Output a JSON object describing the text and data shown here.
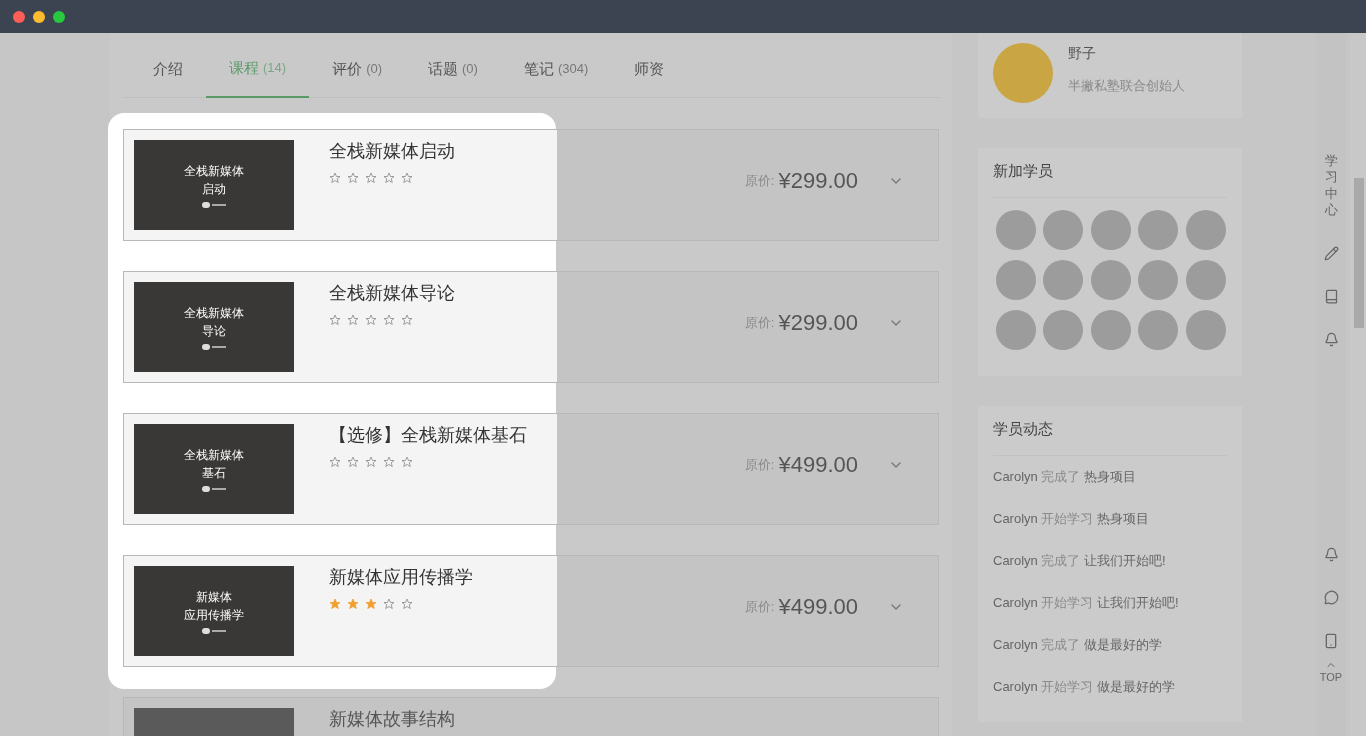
{
  "tabs": [
    {
      "label": "介绍",
      "selected": false
    },
    {
      "label": "课程",
      "count": "(14)",
      "selected": true
    },
    {
      "label": "评价",
      "count": "(0)",
      "selected": false
    },
    {
      "label": "话题",
      "count": "(0)",
      "selected": false
    },
    {
      "label": "笔记",
      "count": "(304)",
      "selected": false
    },
    {
      "label": "师资",
      "selected": false
    }
  ],
  "courses": [
    {
      "title": "全栈新媒体启动",
      "thumb_lines": [
        "全栈新媒体",
        "启动"
      ],
      "stars": 0,
      "price_label": "原价:",
      "price": "¥299.00",
      "highlighted": true
    },
    {
      "title": "全栈新媒体导论",
      "thumb_lines": [
        "全栈新媒体",
        "导论"
      ],
      "stars": 0,
      "price_label": "原价:",
      "price": "¥299.00",
      "highlighted": true
    },
    {
      "title": "【选修】全栈新媒体基石",
      "thumb_lines": [
        "全栈新媒体",
        "基石"
      ],
      "stars": 0,
      "price_label": "原价:",
      "price": "¥499.00",
      "highlighted": true
    },
    {
      "title": "新媒体应用传播学",
      "thumb_lines": [
        "新媒体",
        "应用传播学"
      ],
      "stars": 3,
      "price_label": "原价:",
      "price": "¥499.00",
      "highlighted": true
    },
    {
      "title": "新媒体故事结构",
      "highlighted": false
    }
  ],
  "teacher": {
    "name": "野子",
    "role": "半撇私塾联合创始人"
  },
  "new_students": {
    "title": "新加学员"
  },
  "activity": {
    "title": "学员动态",
    "items": [
      {
        "user": "Carolyn",
        "action": "完成了",
        "target": "热身项目"
      },
      {
        "user": "Carolyn",
        "action": "开始学习",
        "target": "热身项目"
      },
      {
        "user": "Carolyn",
        "action": "完成了",
        "target": "让我们开始吧!"
      },
      {
        "user": "Carolyn",
        "action": "开始学习",
        "target": "让我们开始吧!"
      },
      {
        "user": "Carolyn",
        "action": "完成了",
        "target": "做是最好的学"
      },
      {
        "user": "Carolyn",
        "action": "开始学习",
        "target": "做是最好的学"
      }
    ]
  },
  "side_toolbar": {
    "label": "学习中心",
    "top": "TOP"
  }
}
